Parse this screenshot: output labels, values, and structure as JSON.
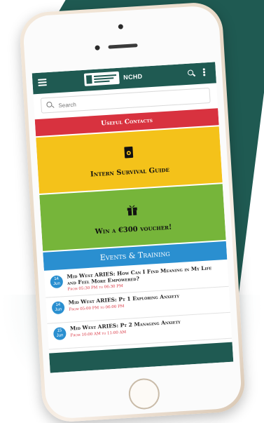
{
  "app": {
    "title": "NCHD",
    "logo_text": "HSE"
  },
  "search": {
    "placeholder": "Search"
  },
  "tiles": {
    "useful_contacts": "Useful Contacts",
    "intern_survival_guide": "Intern Survival Guide",
    "voucher": "Win a €300 voucher!",
    "events_training": "Events & Training"
  },
  "events": [
    {
      "date_line1": "14",
      "date_line2": "Jun",
      "title": "Mid West ARIES: How Can I Find Meaning in My Life and Feel More Empowered?",
      "time": "From 05:30 PM to 06:30 PM"
    },
    {
      "date_line1": "14",
      "date_line2": "Jun",
      "title": "Mid West ARIES: Pt 1 Exploring Anxiety",
      "time": "From 05:00 PM to 06:00 PM"
    },
    {
      "date_line1": "15",
      "date_line2": "Jun",
      "title": "Mid West ARIES: Pt 2 Managing Anxiety",
      "time": "From 10:00 AM to 11:00 AM"
    }
  ],
  "colors": {
    "header": "#1f5a52",
    "red": "#d8323f",
    "yellow": "#f4c21a",
    "green": "#76b53a",
    "blue": "#2a8fd0"
  },
  "icons": {
    "menu": "menu-icon",
    "search": "search-icon",
    "more": "more-vertical-icon",
    "guide": "book-icon",
    "voucher": "gift-icon"
  }
}
